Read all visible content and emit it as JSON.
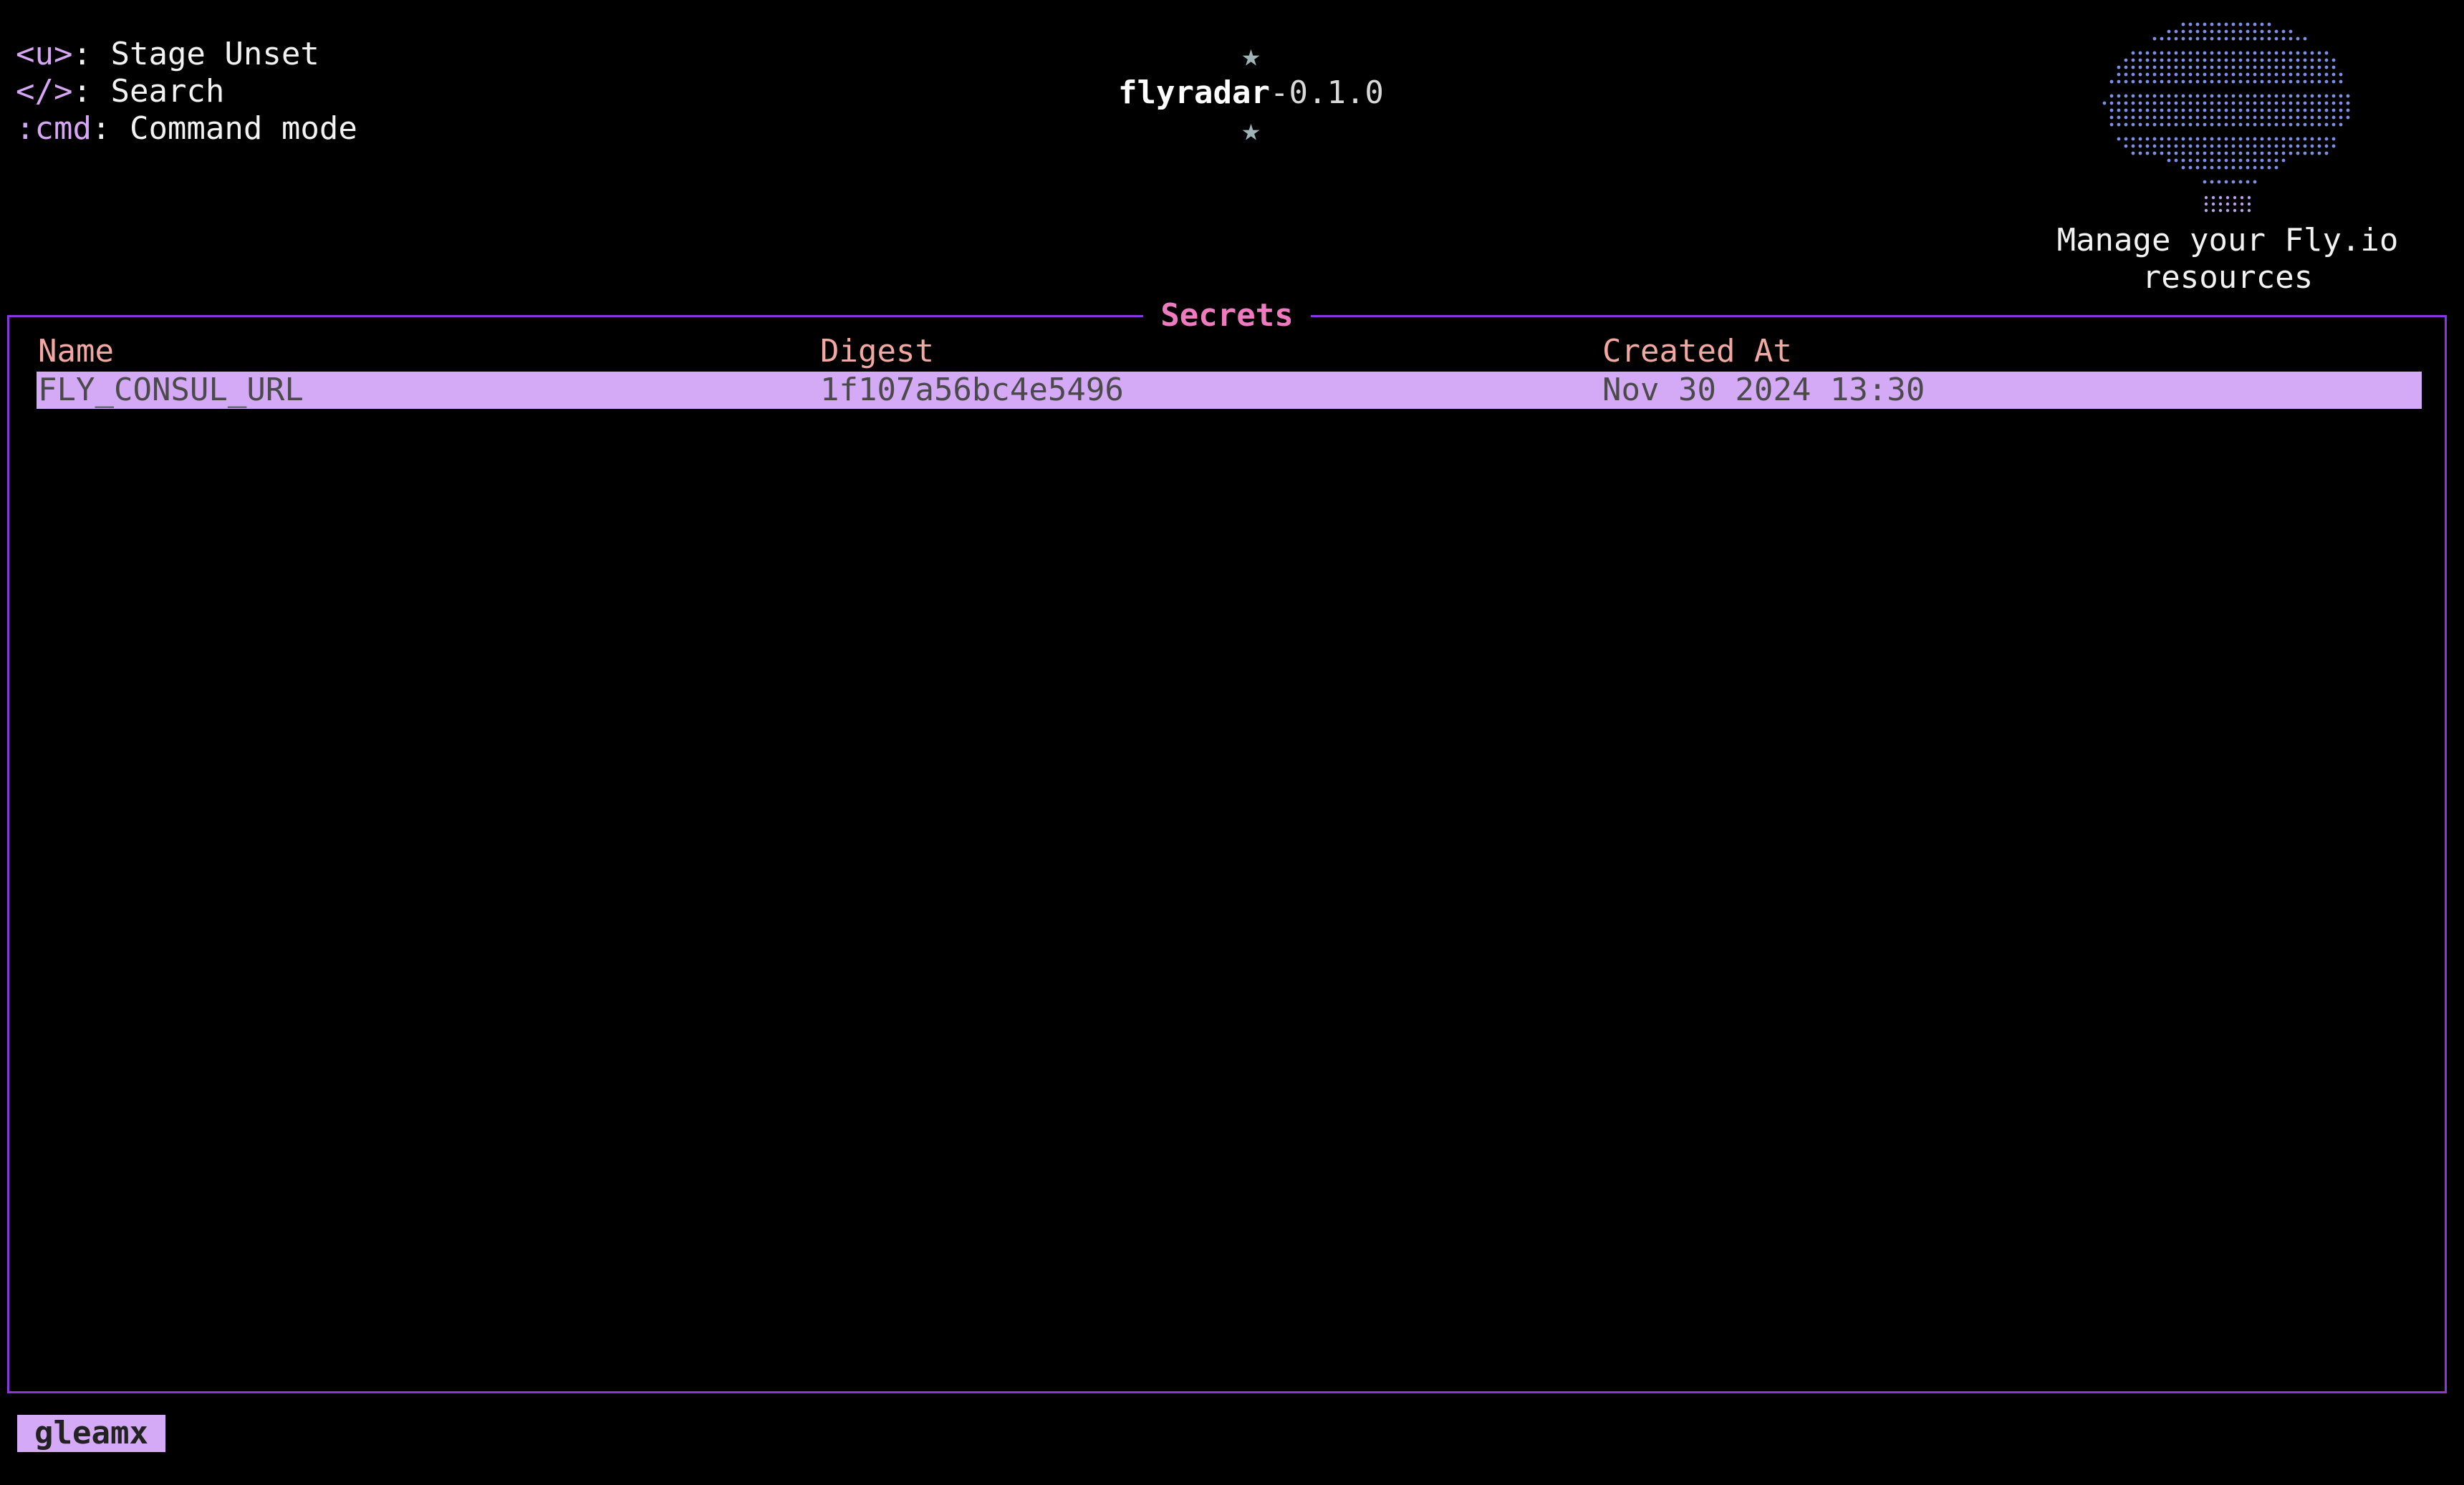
{
  "header": {
    "star": "★",
    "app_name": "flyradar",
    "app_version": "-0.1.0"
  },
  "help": [
    {
      "key": "<u>",
      "sep": ": ",
      "desc": "Stage Unset"
    },
    {
      "key": "</>",
      "sep": ": ",
      "desc": "Search"
    },
    {
      "key": ":cmd",
      "sep": ": ",
      "desc": "Command mode"
    }
  ],
  "logo": {
    "icon": "fly-balloon-dot-logo",
    "color": "#7d8fe6"
  },
  "tagline": "Manage your Fly.io\nresources",
  "panel": {
    "title": "Secrets",
    "columns": [
      "Name",
      "Digest",
      "Created At"
    ],
    "rows": [
      {
        "name": "FLY_CONSUL_URL",
        "digest": "1f107a56bc4e5496",
        "created_at": "Nov 30 2024 13:30",
        "selected": true
      }
    ]
  },
  "context": "gleamx",
  "colors": {
    "accent_border": "#8a35e0",
    "title": "#f07ac0",
    "key": "#d7a6f5",
    "column_header": "#f2a8a0",
    "selection": "#d4a9f5"
  }
}
